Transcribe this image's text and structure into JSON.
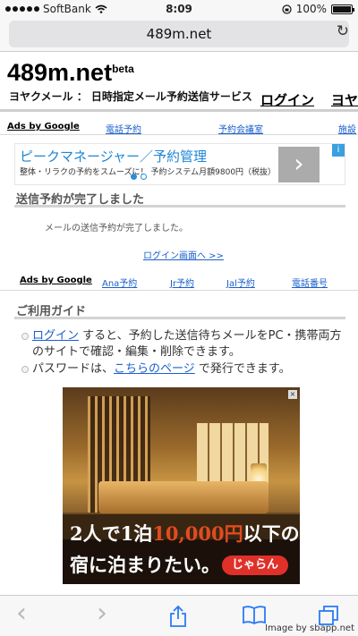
{
  "status": {
    "carrier": "SoftBank",
    "time": "8:09",
    "battery": "100%",
    "battery_level": 1.0
  },
  "browser": {
    "url": "489m.net"
  },
  "header": {
    "title": "489m.net",
    "title_sup": "beta",
    "tagline": "ヨヤクメール ： 日時指定メール予約送信サービス",
    "nav": [
      "ログイン",
      "ヨヤ"
    ]
  },
  "top_links": {
    "ads": "Ads by Google",
    "items": [
      "電話予約",
      "予約会議室",
      "施設"
    ]
  },
  "banner": {
    "title": "ピークマネージャー／予約管理",
    "desc": "整体・リラクの予約をスムーズに！ 予約システム月額9800円（税抜）",
    "arrow": "›",
    "info": "i",
    "pages": 2,
    "active_page": 1
  },
  "complete": {
    "heading": "送信予約が完了しました",
    "message": "メールの送信予約が完了しました。",
    "login_link": "ログイン画面へ >>"
  },
  "mid_links": {
    "ads": "Ads by Google",
    "items": [
      "Ana予約",
      "Jr予約",
      "Jal予約",
      "電話番号"
    ]
  },
  "guide": {
    "heading": "ご利用ガイド",
    "item1": {
      "link": "ログイン",
      "text": " すると、予約した送信待ちメールをPC・携帯両方のサイトで確認・編集・削除できます。"
    },
    "item2": {
      "text1": "パスワードは、",
      "link": "こちらのページ",
      "text2": " で発行できます。"
    }
  },
  "inn_ad": {
    "line1_a": "2人で1泊",
    "line1_price": "10,000円",
    "line1_b": "以下の",
    "line2": "宿に泊まりたい。",
    "logo": "じゃらん",
    "close": "×"
  },
  "toolbar": {
    "back": "‹",
    "forward": "›",
    "credit": "Image by sbapp.net"
  }
}
